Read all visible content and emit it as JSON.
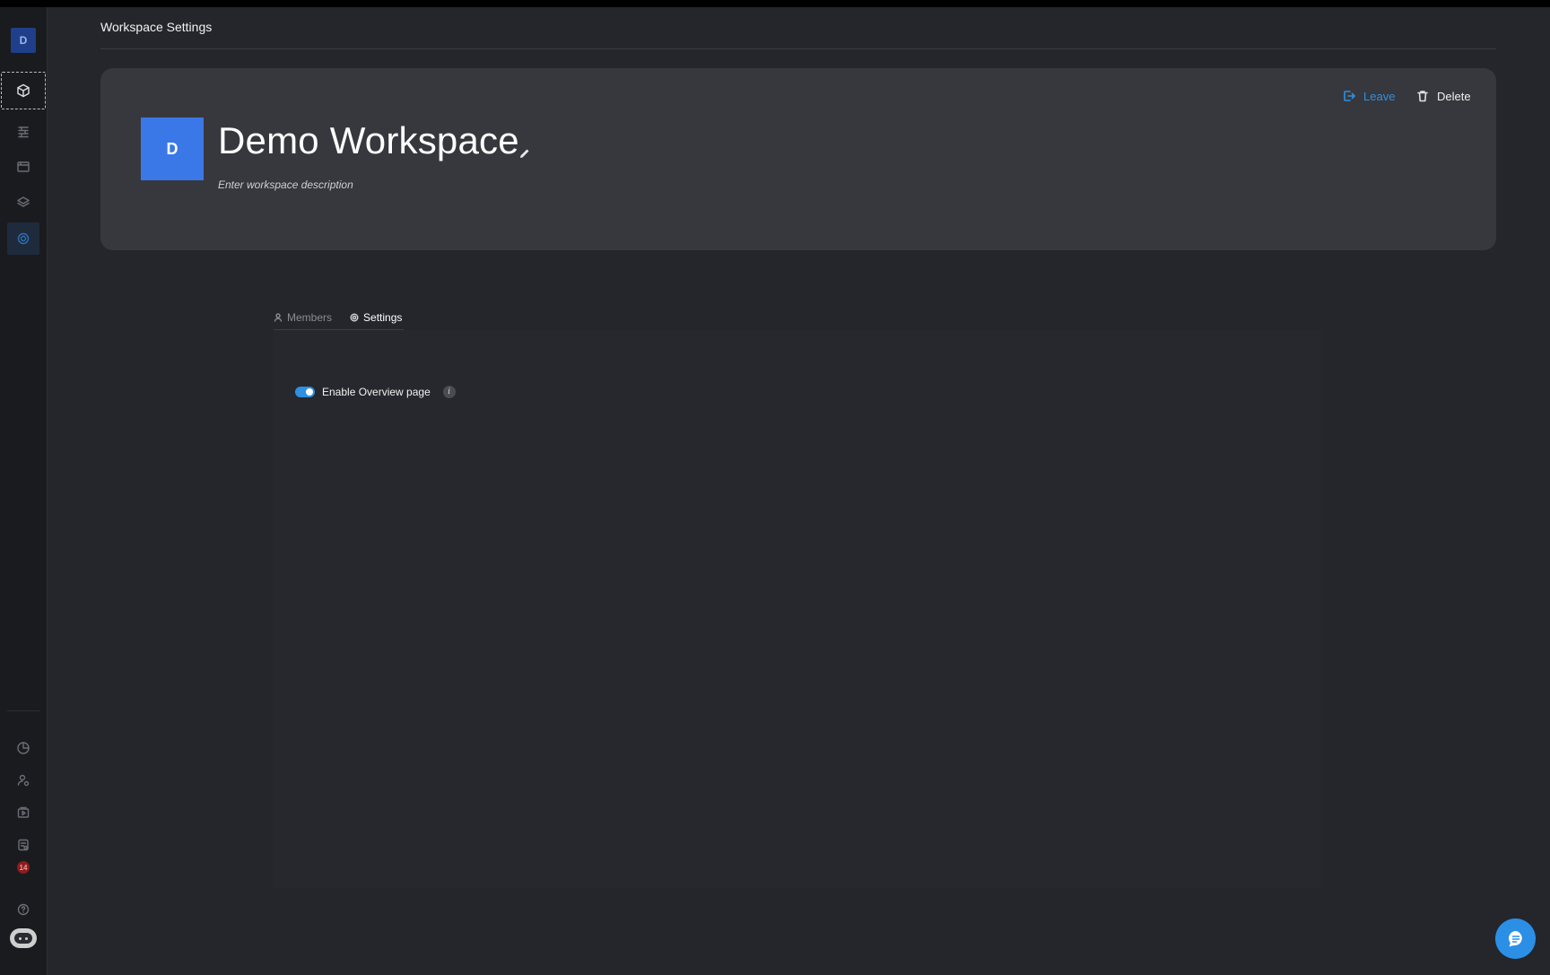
{
  "sidebar": {
    "workspace_initial": "D",
    "top_items": [
      {
        "icon": "cube-icon",
        "state": "focused"
      },
      {
        "icon": "pipelines-icon"
      },
      {
        "icon": "window-icon"
      },
      {
        "icon": "layers-icon"
      },
      {
        "icon": "settings-gear-icon",
        "state": "active"
      }
    ],
    "bottom_items": [
      {
        "icon": "pie-chart-icon"
      },
      {
        "icon": "users-icon"
      },
      {
        "icon": "play-box-icon"
      },
      {
        "icon": "reports-icon"
      },
      {
        "icon": "notifications-icon",
        "badge": "14"
      },
      {
        "icon": "help-icon"
      },
      {
        "icon": "bot-icon"
      }
    ]
  },
  "header": {
    "title": "Workspace Settings"
  },
  "workspace": {
    "initial": "D",
    "name": "Demo Workspace",
    "description_placeholder": "Enter workspace description",
    "actions": {
      "leave_label": "Leave",
      "delete_label": "Delete"
    }
  },
  "tabs": [
    {
      "label": "Members",
      "icon": "user-icon",
      "active": false
    },
    {
      "label": "Settings",
      "icon": "gear-icon",
      "active": true
    }
  ],
  "settings": {
    "enable_overview": {
      "label": "Enable Overview page",
      "enabled": true,
      "info_glyph": "i"
    }
  },
  "colors": {
    "accent": "#2f8fe0",
    "avatar": "#3b78e7",
    "background": "#24262c",
    "card": "#37383d"
  }
}
